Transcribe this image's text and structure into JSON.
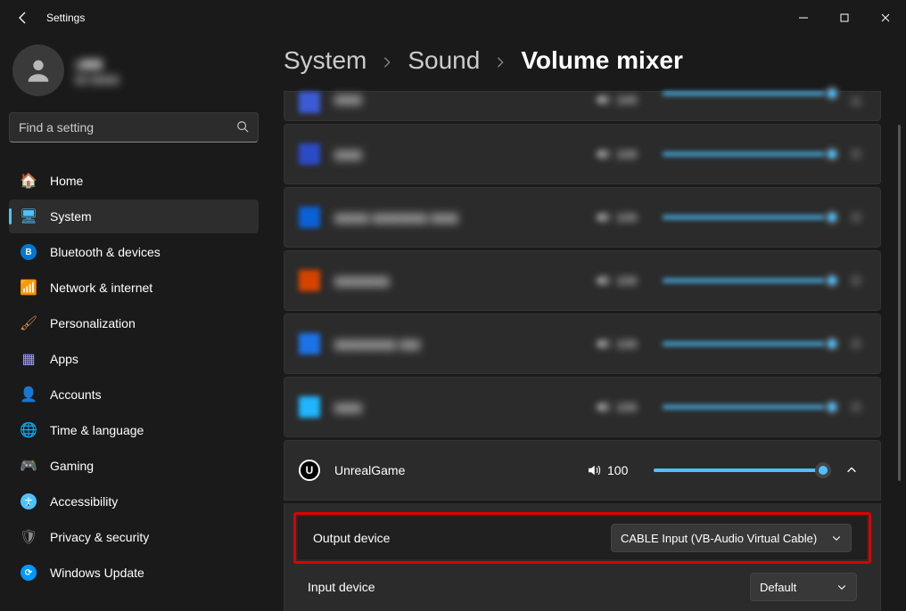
{
  "window": {
    "title": "Settings"
  },
  "account": {
    "name": "g▮▮▮",
    "email": "▮▮ ▮▮▮▮▮"
  },
  "search": {
    "placeholder": "Find a setting"
  },
  "sidebar": {
    "items": [
      {
        "label": "Home",
        "icon": "🏠",
        "color": "#f7b239"
      },
      {
        "label": "System",
        "icon": "🖥",
        "color": "#4cc2ff",
        "active": true
      },
      {
        "label": "Bluetooth & devices",
        "icon": "B",
        "color": "#0078d4",
        "round": true
      },
      {
        "label": "Network & internet",
        "icon": "📶",
        "color": "#00b7ff"
      },
      {
        "label": "Personalization",
        "icon": "🖌",
        "color": "#d18a5a"
      },
      {
        "label": "Apps",
        "icon": "▦",
        "color": "#a09cff"
      },
      {
        "label": "Accounts",
        "icon": "👤",
        "color": "#ffb84d"
      },
      {
        "label": "Time & language",
        "icon": "🌐",
        "color": "#6fb5e0"
      },
      {
        "label": "Gaming",
        "icon": "🎮",
        "color": "#8a8a8a"
      },
      {
        "label": "Accessibility",
        "icon": "✖",
        "color": "#4cc2ff",
        "round": true,
        "iconGlyph": "accessibility"
      },
      {
        "label": "Privacy & security",
        "icon": "🛡",
        "color": "#8a8a8a"
      },
      {
        "label": "Windows Update",
        "icon": "⟳",
        "color": "#0099ff",
        "round": true
      }
    ]
  },
  "breadcrumb": {
    "a": "System",
    "b": "Sound",
    "c": "Volume mixer"
  },
  "apps": [
    {
      "name": "▮▮▮▮",
      "volume": 100,
      "iconColor": "#3b5bd6",
      "blurred": true
    },
    {
      "name": "▮▮▮▮",
      "volume": 100,
      "iconColor": "#2b4bc6",
      "blurred": true
    },
    {
      "name": "▮▮▮▮▮ ▮▮▮▮▮▮▮▮ ▮▮▮▮",
      "volume": 100,
      "iconColor": "#0b61d6",
      "blurred": true
    },
    {
      "name": "▮▮▮▮▮▮▮▮",
      "volume": 100,
      "iconColor": "#d64300",
      "blurred": true
    },
    {
      "name": "▮▮▮▮▮▮▮▮▮ ▮▮▮",
      "volume": 100,
      "iconColor": "#1b73e8",
      "blurred": true
    },
    {
      "name": "▮▮▮▮",
      "volume": 100,
      "iconColor": "#1fb6ff",
      "blurred": true
    }
  ],
  "unreal": {
    "name": "UnrealGame",
    "volume": 100
  },
  "output": {
    "label": "Output device",
    "selected": "CABLE Input (VB-Audio Virtual Cable)"
  },
  "input": {
    "label": "Input device",
    "selected": "Default"
  }
}
